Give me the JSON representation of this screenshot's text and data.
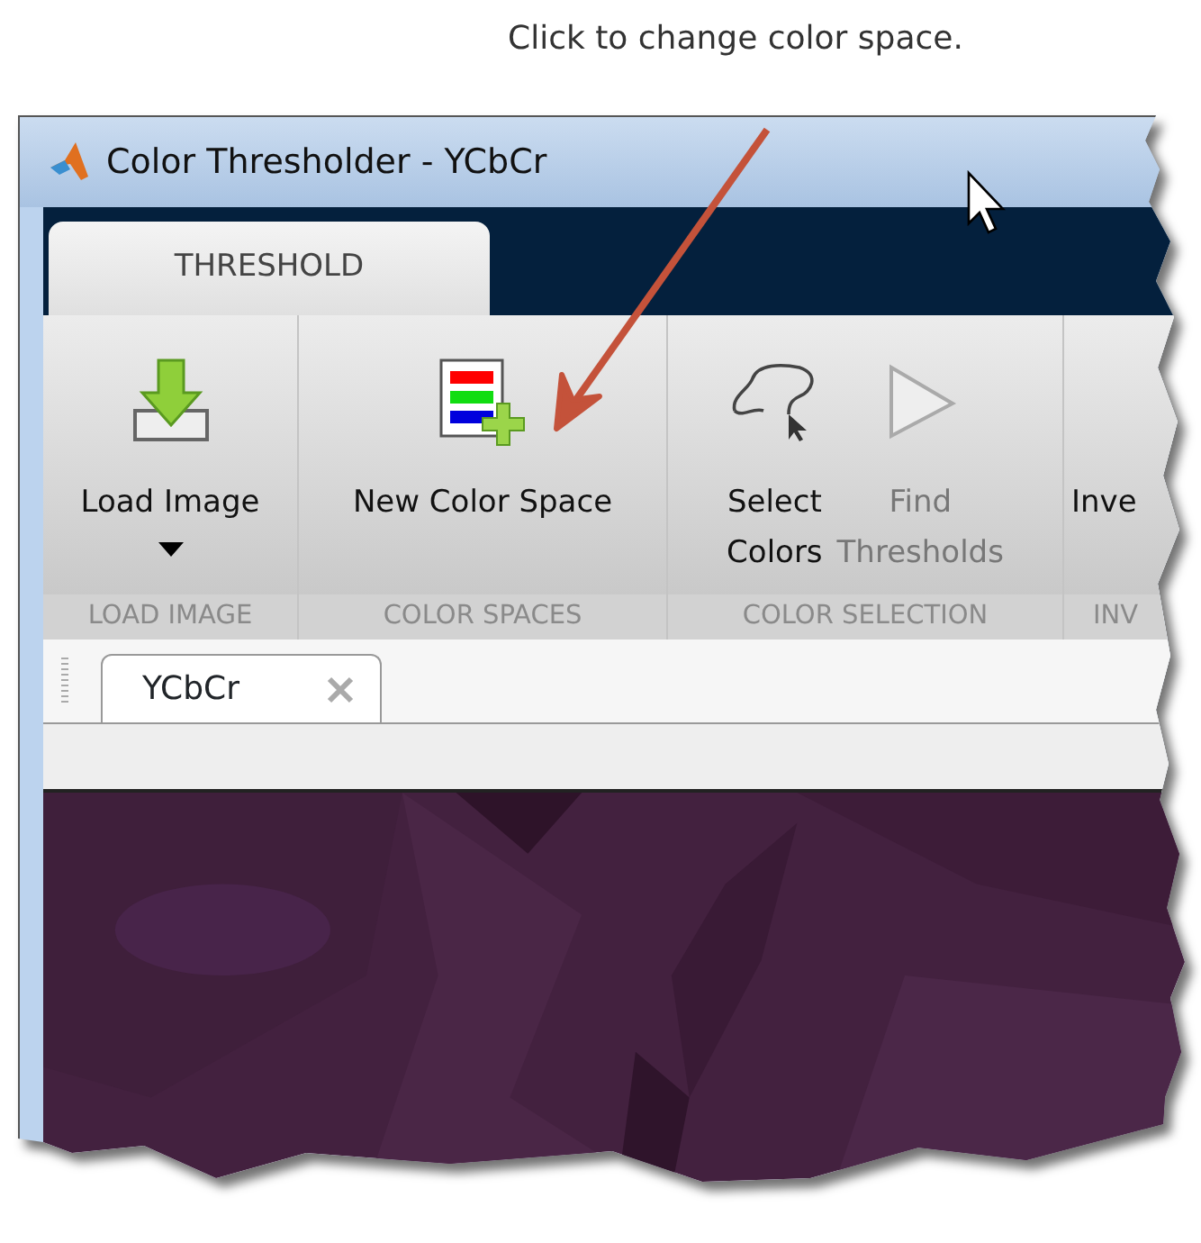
{
  "annotation": {
    "text": "Click to change color space."
  },
  "window": {
    "title": "Color Thresholder - YCbCr"
  },
  "ribbon_tabs": [
    {
      "label": "THRESHOLD",
      "selected": true
    }
  ],
  "ribbon_groups": [
    {
      "label": "LOAD IMAGE",
      "buttons": [
        {
          "label": "Load Image",
          "kind": "load",
          "dropdown": true,
          "disabled": false
        }
      ]
    },
    {
      "label": "COLOR SPACES",
      "buttons": [
        {
          "label": "New Color Space",
          "kind": "colorspace",
          "disabled": false
        }
      ]
    },
    {
      "label": "COLOR SELECTION",
      "buttons": [
        {
          "label": "Select Colors",
          "kind": "lasso",
          "disabled": false
        },
        {
          "label": "Find Thresholds",
          "kind": "play",
          "disabled": true
        }
      ]
    },
    {
      "label": "INV",
      "buttons": [
        {
          "label": "Inve",
          "kind": "cut",
          "disabled": false
        }
      ]
    }
  ],
  "document_tabs": [
    {
      "label": "YCbCr",
      "selected": true
    }
  ]
}
